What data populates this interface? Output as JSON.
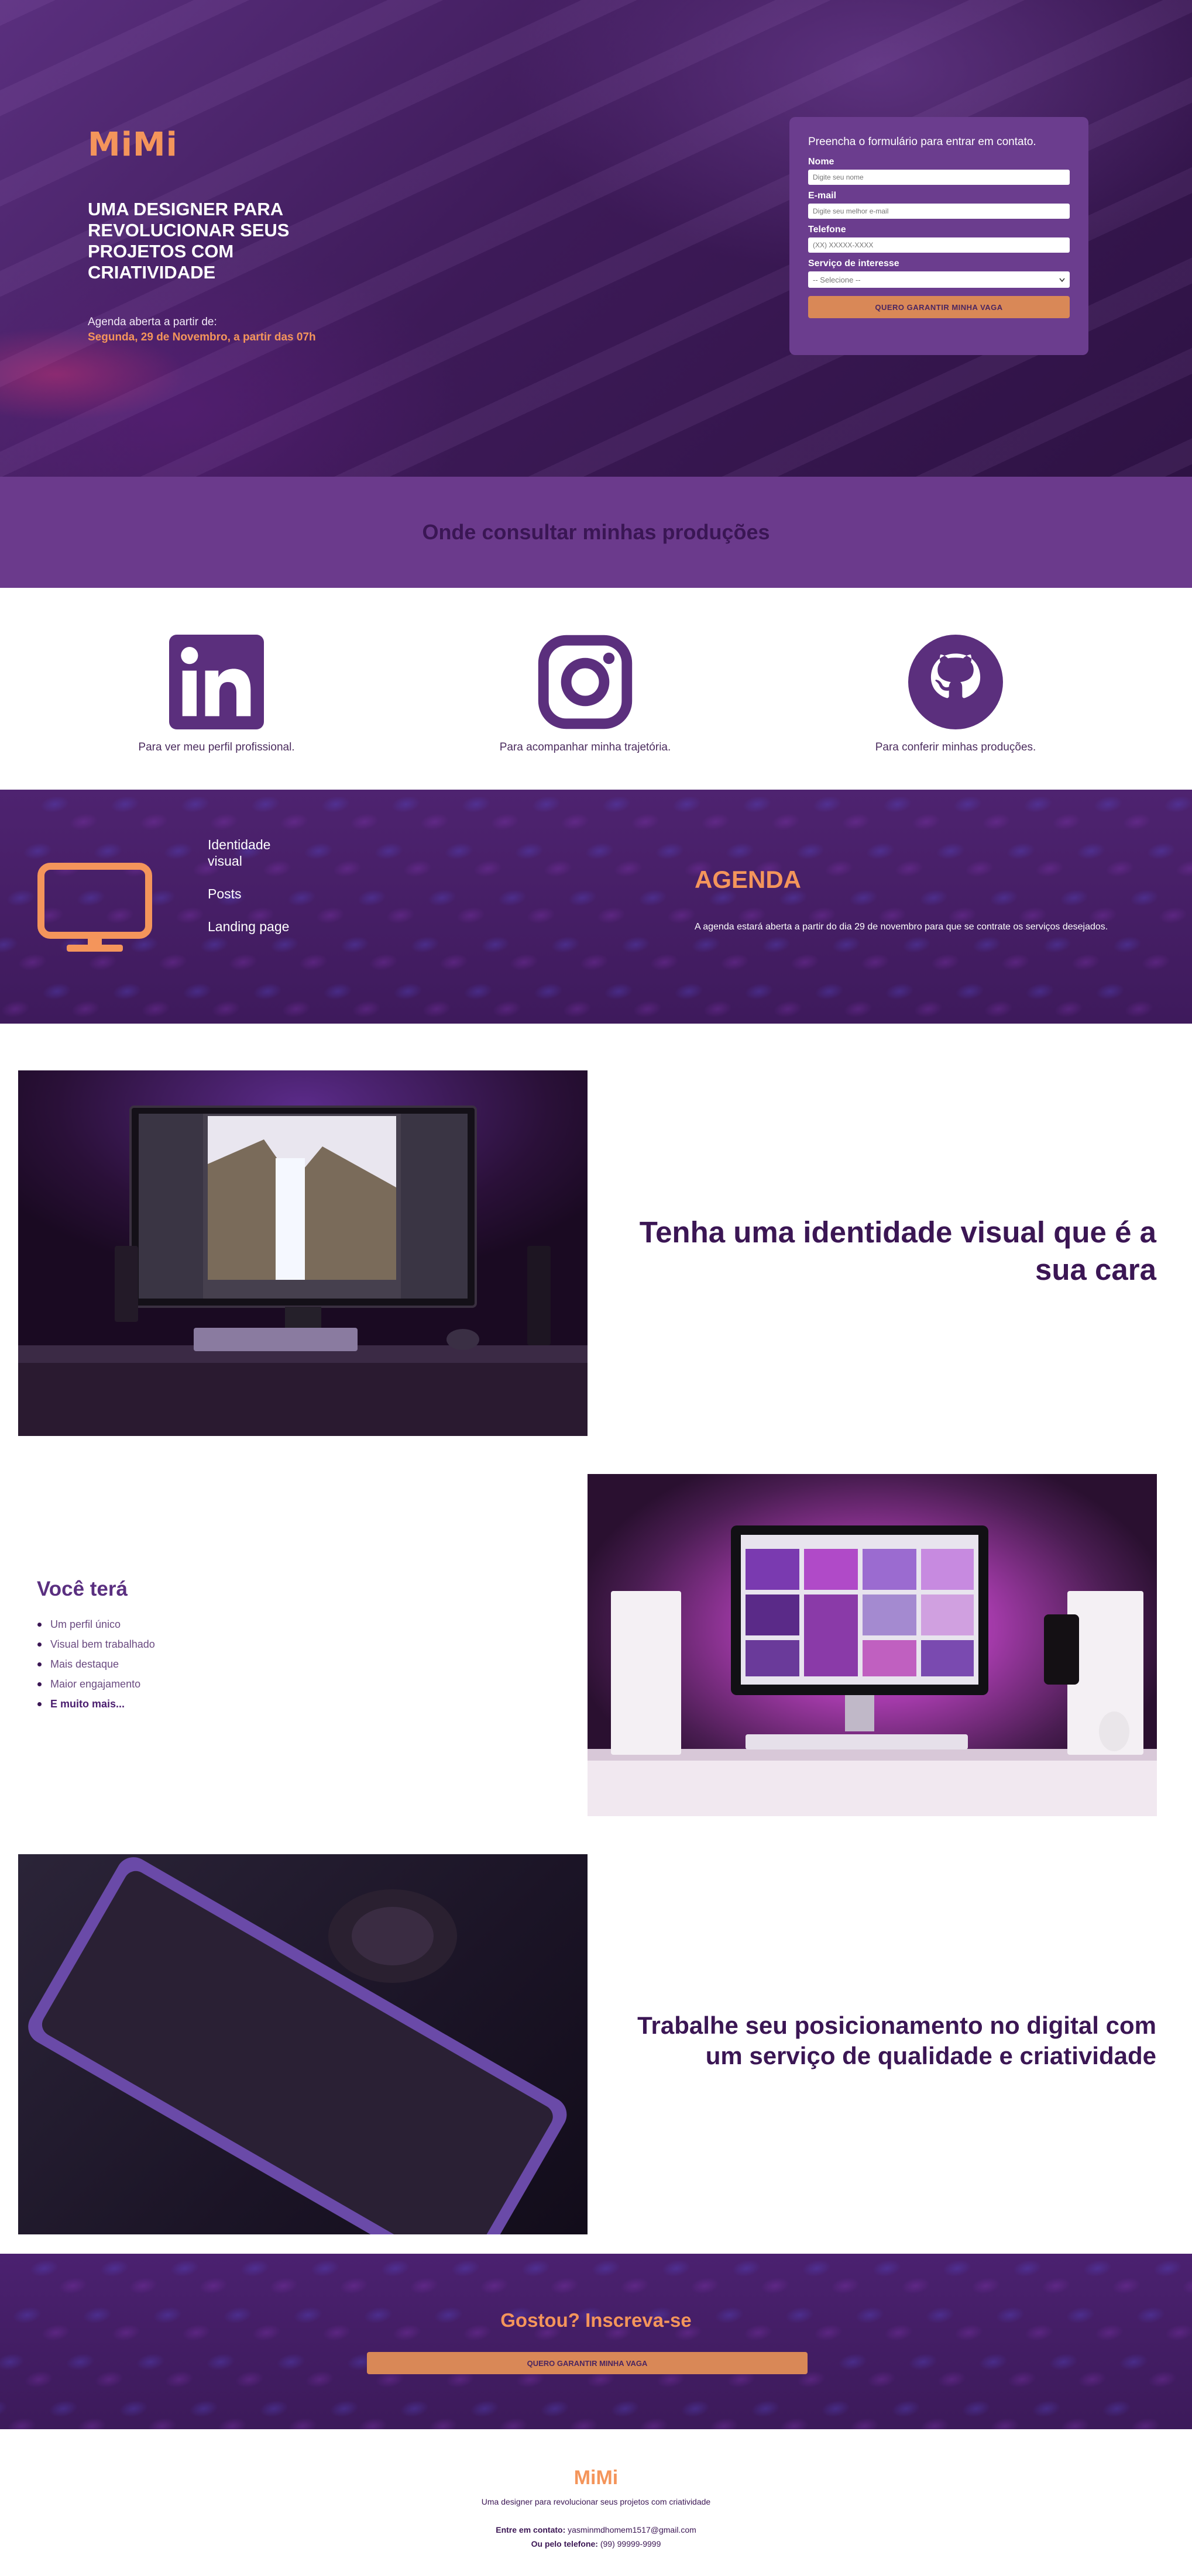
{
  "brand": {
    "logo": "MiMi",
    "accent": "#f4955b",
    "primary": "#6b3a8c",
    "dark": "#3b1654"
  },
  "hero": {
    "headline": "UMA DESIGNER PARA REVOLUCIONAR SEUS PROJETOS COM CRIATIVIDADE",
    "schedule_label": "Agenda aberta a partir de:",
    "schedule_date": "Segunda, 29 de Novembro, a partir das 07h"
  },
  "form": {
    "title": "Preencha o formulário para entrar em contato.",
    "name_label": "Nome",
    "name_placeholder": "Digite seu nome",
    "email_label": "E-mail",
    "email_placeholder": "Digite seu melhor e-mail",
    "phone_label": "Telefone",
    "phone_placeholder": "(XX) XXXXX-XXXX",
    "service_label": "Serviço de interesse",
    "service_value": "-- Selecione --",
    "submit": "QUERO GARANTIR MINHA VAGA"
  },
  "consult": {
    "title": "Onde consultar minhas produções",
    "items": [
      {
        "icon": "linkedin-icon",
        "caption": "Para ver meu perfil profissional."
      },
      {
        "icon": "instagram-icon",
        "caption": "Para acompanhar minha trajetória."
      },
      {
        "icon": "github-icon",
        "caption": "Para conferir minhas produções."
      }
    ]
  },
  "agenda": {
    "services": [
      "Identidade visual",
      "Posts",
      "Landing page"
    ],
    "title": "AGENDA",
    "text": "A agenda estará aberta a partir do dia 29 de novembro para que se contrate os serviços desejados."
  },
  "features": {
    "identity_title": "Tenha uma identidade visual que é a sua cara",
    "benefits_title": "Você terá",
    "benefits": [
      "Um perfil único",
      "Visual bem trabalhado",
      "Mais destaque",
      "Maior engajamento",
      "E muito mais..."
    ],
    "positioning_title": "Trabalhe seu posicionamento no digital com um serviço de qualidade e criatividade"
  },
  "cta": {
    "title": "Gostou? Inscreva-se",
    "button": "QUERO GARANTIR MINHA VAGA"
  },
  "footer": {
    "logo": "MiMi",
    "tagline": "Uma designer para revolucionar seus projetos com criatividade",
    "email_label": "Entre em contato:",
    "email": "yasminmdhomem1517@gmail.com",
    "phone_label": "Ou pelo telefone:",
    "phone": "(99) 99999-9999"
  }
}
